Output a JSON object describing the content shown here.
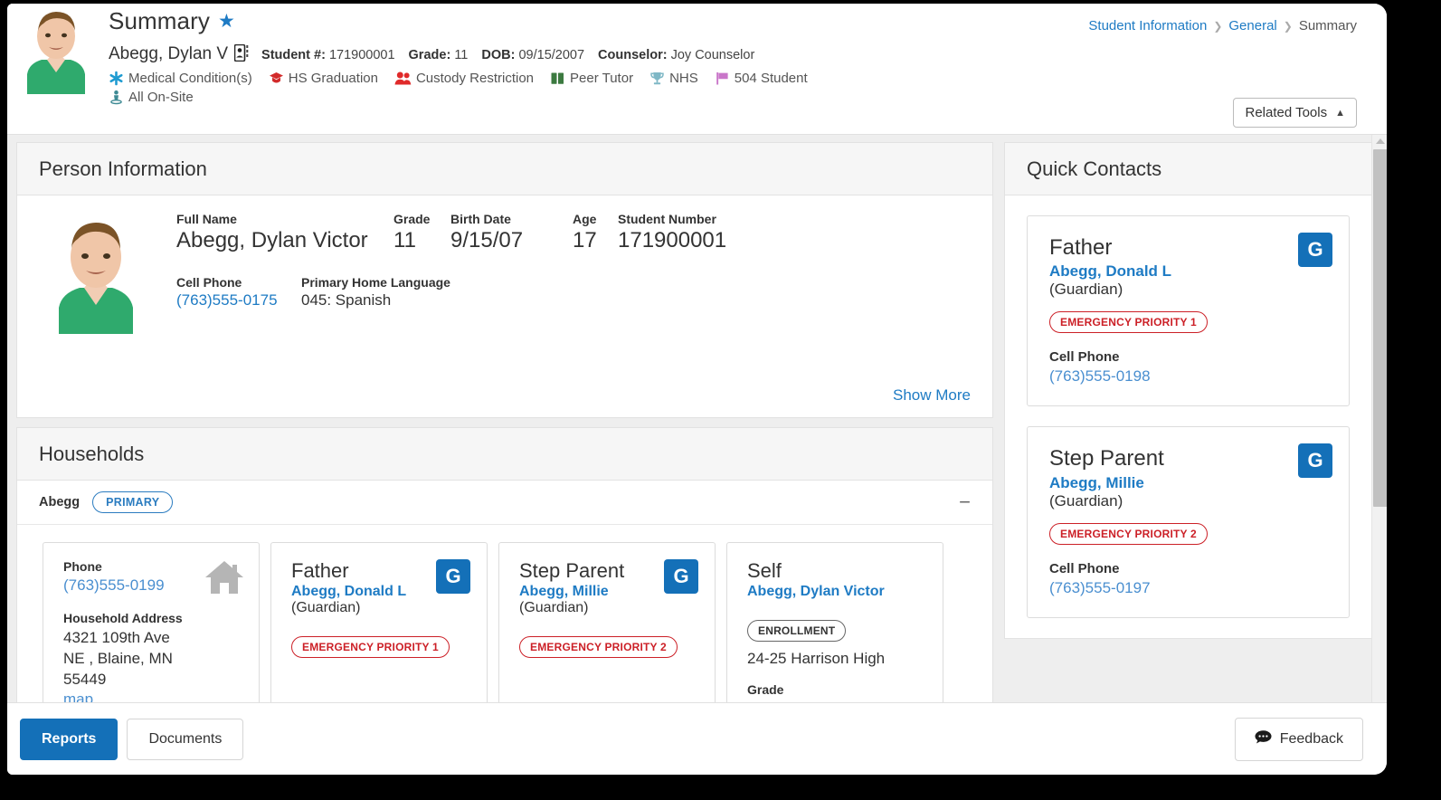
{
  "header": {
    "page_title": "Summary",
    "favorite_icon": "star-icon",
    "person_name": "Abegg, Dylan V",
    "idcard_icon": "id-card-icon",
    "demographics": [
      {
        "label": "Student #:",
        "value": "171900001"
      },
      {
        "label": "Grade:",
        "value": "11"
      },
      {
        "label": "DOB:",
        "value": "09/15/2007"
      },
      {
        "label": "Counselor:",
        "value": "Joy Counselor"
      }
    ],
    "flags_row1": [
      {
        "icon": "asterisk-icon",
        "label": "Medical Condition(s)",
        "color": "#1f9bd1"
      },
      {
        "icon": "graduation-cap-icon",
        "label": "HS Graduation",
        "color": "#d22b2b"
      },
      {
        "icon": "people-icon",
        "label": "Custody Restriction",
        "color": "#e02a2a"
      },
      {
        "icon": "book-icon",
        "label": "Peer Tutor",
        "color": "#3c7a40"
      },
      {
        "icon": "trophy-icon",
        "label": "NHS",
        "color": "#7fb8c6"
      },
      {
        "icon": "flag-icon",
        "label": "504 Student",
        "color": "#c976c9"
      }
    ],
    "flags_row2": [
      {
        "icon": "person-pin-icon",
        "label": "All On-Site",
        "color": "#3e8a94"
      }
    ],
    "breadcrumb": [
      "Student Information",
      "General",
      "Summary"
    ],
    "related_tools_label": "Related Tools",
    "related_tools_caret": "chevron-up-icon"
  },
  "person_information": {
    "title": "Person Information",
    "fields": [
      {
        "label": "Full Name",
        "value": "Abegg, Dylan Victor"
      },
      {
        "label": "Grade",
        "value": "11"
      },
      {
        "label": "Birth Date",
        "value": "9/15/07"
      },
      {
        "label": "Age",
        "value": "17"
      },
      {
        "label": "Student Number",
        "value": "171900001"
      }
    ],
    "cell_phone_label": "Cell Phone",
    "cell_phone_value": "(763)555-0175",
    "language_label": "Primary Home Language",
    "language_value": "045: Spanish",
    "show_more": "Show More"
  },
  "households": {
    "title": "Households",
    "household_name": "Abegg",
    "primary_badge": "PRIMARY",
    "collapse_icon": "minus-icon",
    "address_card": {
      "phone_label": "Phone",
      "phone_value": "(763)555-0199",
      "address_label": "Household Address",
      "address_value": "4321 109th Ave NE , Blaine, MN 55449",
      "map_link": "map",
      "house_icon": "house-icon"
    },
    "member_cards": [
      {
        "role": "Father",
        "person": "Abegg, Donald L",
        "relationship": "(Guardian)",
        "badge_letter": "G",
        "pill": "EMERGENCY PRIORITY 1",
        "pill_type": "emergency"
      },
      {
        "role": "Step Parent",
        "person": "Abegg, Millie",
        "relationship": "(Guardian)",
        "badge_letter": "G",
        "pill": "EMERGENCY PRIORITY 2",
        "pill_type": "emergency"
      },
      {
        "role": "Self",
        "person": "Abegg, Dylan Victor",
        "relationship": "",
        "badge_letter": "",
        "pill": "ENROLLMENT",
        "pill_type": "enrollment",
        "enrollment_value": "24-25 Harrison High",
        "grade_label": "Grade"
      }
    ]
  },
  "quick_contacts": {
    "title": "Quick Contacts",
    "cards": [
      {
        "role": "Father",
        "person": "Abegg, Donald L",
        "relationship": "(Guardian)",
        "badge_letter": "G",
        "pill": "EMERGENCY PRIORITY 1",
        "phone_label": "Cell Phone",
        "phone_value": "(763)555-0198"
      },
      {
        "role": "Step Parent",
        "person": "Abegg, Millie",
        "relationship": "(Guardian)",
        "badge_letter": "G",
        "pill": "EMERGENCY PRIORITY 2",
        "phone_label": "Cell Phone",
        "phone_value": "(763)555-0197"
      }
    ]
  },
  "footer": {
    "reports_label": "Reports",
    "documents_label": "Documents",
    "feedback_label": "Feedback",
    "feedback_icon": "comment-icon"
  },
  "colors": {
    "accent_blue": "#1470b8",
    "link_blue": "#1e7bc4",
    "emergency_red": "#cc2027",
    "panel_bg": "#eeeeee"
  }
}
